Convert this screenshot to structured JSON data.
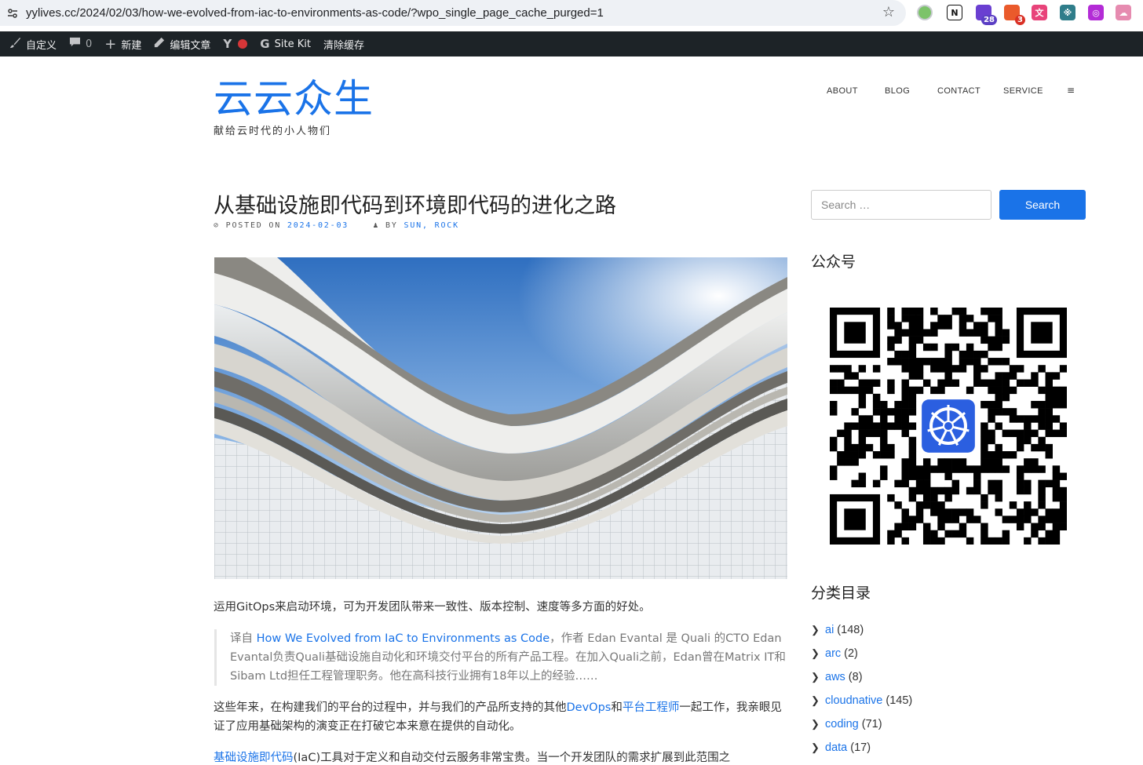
{
  "browser": {
    "url": "yylives.cc/2024/02/03/how-we-evolved-from-iac-to-environments-as-code/?wpo_single_page_cache_purged=1",
    "extensions": [
      {
        "name": "green-dot-extension",
        "color": "#9aa0a6",
        "label": "",
        "badge": ""
      },
      {
        "name": "notion-extension",
        "color": "#ffffff",
        "label": "N",
        "badge": ""
      },
      {
        "name": "house-extension",
        "color": "#6a3fd1",
        "label": "",
        "badge": "28"
      },
      {
        "name": "stack-extension",
        "color": "#ea5a2b",
        "label": "",
        "badge": "3"
      },
      {
        "name": "translate-extension",
        "color": "#e8437a",
        "label": "文",
        "badge": ""
      },
      {
        "name": "teal-extension",
        "color": "#2f7d8a",
        "label": "※",
        "badge": ""
      },
      {
        "name": "purple-extension",
        "color": "#b32bd6",
        "label": "◎",
        "badge": ""
      },
      {
        "name": "cloud-extension",
        "color": "#e68bb0",
        "label": "☁",
        "badge": ""
      }
    ]
  },
  "adminbar": {
    "customize": "自定义",
    "comments_count": "0",
    "new": "新建",
    "edit_post": "编辑文章",
    "site_kit": "Site Kit",
    "clear_cache": "清除缓存"
  },
  "site": {
    "title": "云云众生",
    "tagline": "献给云时代的小人物们"
  },
  "nav": {
    "items": [
      "ABOUT",
      "BLOG",
      "CONTACT",
      "SERVICE"
    ],
    "menu_icon": "≡"
  },
  "post": {
    "title": "从基础设施即代码到环境即代码的进化之路",
    "posted_on_label": "POSTED ON",
    "date": "2024-02-03",
    "by_label": "BY",
    "author": "SUN, ROCK",
    "intro": "运用GitOps来启动环境，可为开发团队带来一致性、版本控制、速度等多方面的好处。",
    "quote": {
      "prefix": "译自 ",
      "link": "How We Evolved from IaC to Environments as Code",
      "rest": "，作者 Edan Evantal 是 Quali 的CTO Edan Evantal负责Quali基础设施自动化和环境交付平台的所有产品工程。在加入Quali之前，Edan曾在Matrix IT和Sibam Ltd担任工程管理职务。他在高科技行业拥有18年以上的经验……"
    },
    "para2": {
      "part1": "这些年来，在构建我们的平台的过程中，并与我们的产品所支持的其他",
      "link1": "DevOps",
      "part2": "和",
      "link2": "平台工程师",
      "part3": "一起工作，我亲眼见证了应用基础架构的演变正在打破它本来意在提供的自动化。"
    },
    "para3": {
      "link": "基础设施即代码",
      "rest": "(IaC)工具对于定义和自动交付云服务非常宝贵。当一个开发团队的需求扩展到此范围之"
    }
  },
  "sidebar": {
    "search_placeholder": "Search …",
    "search_button": "Search",
    "wechat_title": "公众号",
    "categories_title": "分类目录",
    "categories": [
      {
        "name": "ai",
        "count": "(148)"
      },
      {
        "name": "arc",
        "count": "(2)"
      },
      {
        "name": "aws",
        "count": "(8)"
      },
      {
        "name": "cloudnative",
        "count": "(145)"
      },
      {
        "name": "coding",
        "count": "(71)"
      },
      {
        "name": "data",
        "count": "(17)"
      }
    ]
  }
}
